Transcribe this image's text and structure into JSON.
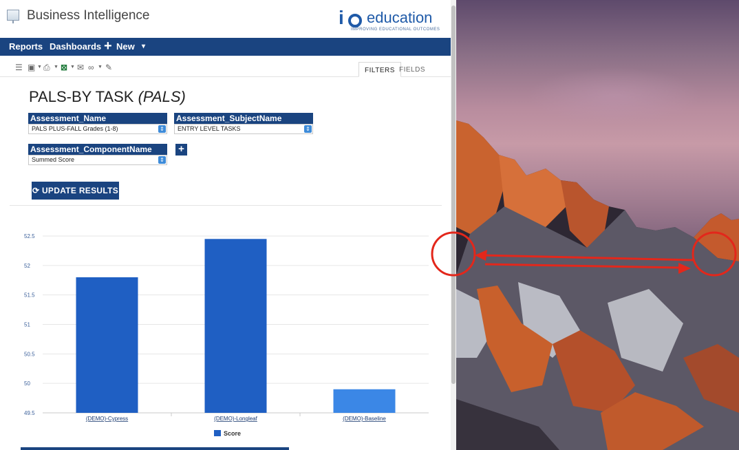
{
  "app": {
    "title": "Business Intelligence",
    "logo": {
      "letter": "i",
      "word": "education",
      "tagline": "IMPROVING EDUCATIONAL OUTCOMES"
    }
  },
  "nav": {
    "reports": "Reports",
    "dashboards": "Dashboards",
    "new": "New",
    "caret": "▾"
  },
  "toolbar": {
    "tabs": {
      "filters": "FILTERS",
      "fields": "FIELDS"
    }
  },
  "report": {
    "title_main": "PALS-BY TASK ",
    "title_sub": "(PALS)",
    "update_button": "UPDATE RESULTS"
  },
  "filters": [
    {
      "label": "Assessment_Name",
      "value": "PALS PLUS-FALL Grades (1-8)"
    },
    {
      "label": "Assessment_SubjectName",
      "value": "ENTRY LEVEL TASKS"
    },
    {
      "label": "Assessment_ComponentName",
      "value": "Summed Score"
    }
  ],
  "add_filter": "+",
  "colors": {
    "nav": "#1a4480",
    "bar_dark": "#1f5fc3",
    "bar_light": "#3b87e6",
    "annotation": "#e3271b"
  },
  "chart_data": {
    "type": "bar",
    "categories": [
      "(DEMO)-Cypress",
      "(DEMO)-Longleaf",
      "(DEMO)-Baseline"
    ],
    "series": [
      {
        "name": "Score",
        "values": [
          51.8,
          52.45,
          49.9
        ]
      }
    ],
    "yticks": [
      "52.5",
      "52",
      "51.5",
      "51",
      "50.5",
      "50",
      "49.5"
    ],
    "ylim": [
      49.5,
      52.5
    ],
    "grid": true,
    "legend": "bottom"
  },
  "wallpaper": {
    "annotations": "two red circles joined by a double-headed arrow"
  }
}
